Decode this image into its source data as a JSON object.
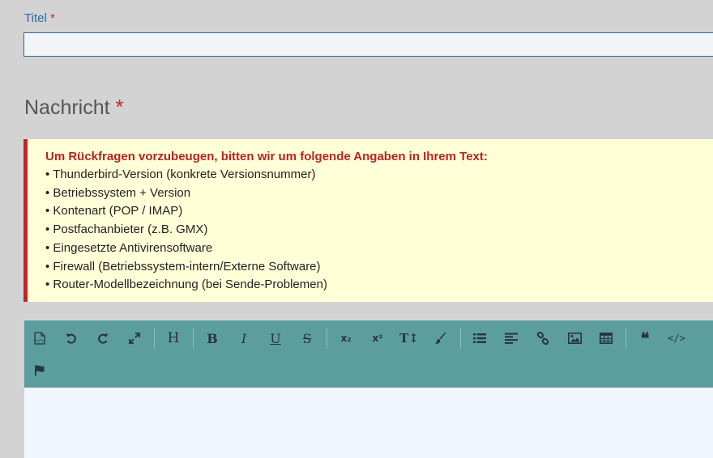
{
  "title_field": {
    "label": "Titel",
    "required_mark": "*",
    "value": ""
  },
  "message": {
    "heading": "Nachricht",
    "required_mark": "*"
  },
  "hint": {
    "title": "Um Rückfragen vorzubeugen, bitten wir um folgende Angaben in Ihrem Text:",
    "items": [
      "Thunderbird-Version (konkrete Versionsnummer)",
      "Betriebssystem + Version",
      "Kontenart (POP / IMAP)",
      "Postfachanbieter (z.B. GMX)",
      "Eingesetzte Antivirensoftware",
      "Firewall (Betriebssystem-intern/Externe Software)",
      "Router-Modellbezeichnung (bei Sende-Problemen)"
    ],
    "border_color": "#c42424",
    "background_color": "#ffffd8"
  },
  "toolbar": {
    "background_color": "#5c9e9f",
    "heading_label": "H",
    "bold_label": "B",
    "italic_label": "I",
    "underline_label": "U",
    "strike_label": "S",
    "subscript_label": "x₂",
    "superscript_label": "x²",
    "text_size_label": "T↕",
    "quote_label": "❝",
    "code_label": "</>",
    "icons": [
      "source-code-icon",
      "undo-icon",
      "redo-icon",
      "fullscreen-icon",
      "heading-icon",
      "bold-icon",
      "italic-icon",
      "underline-icon",
      "strikethrough-icon",
      "subscript-icon",
      "superscript-icon",
      "text-size-icon",
      "paint-brush-icon",
      "list-icon",
      "align-left-icon",
      "link-icon",
      "image-icon",
      "table-icon",
      "quote-icon",
      "code-icon",
      "flag-icon"
    ]
  },
  "editor": {
    "content": ""
  }
}
